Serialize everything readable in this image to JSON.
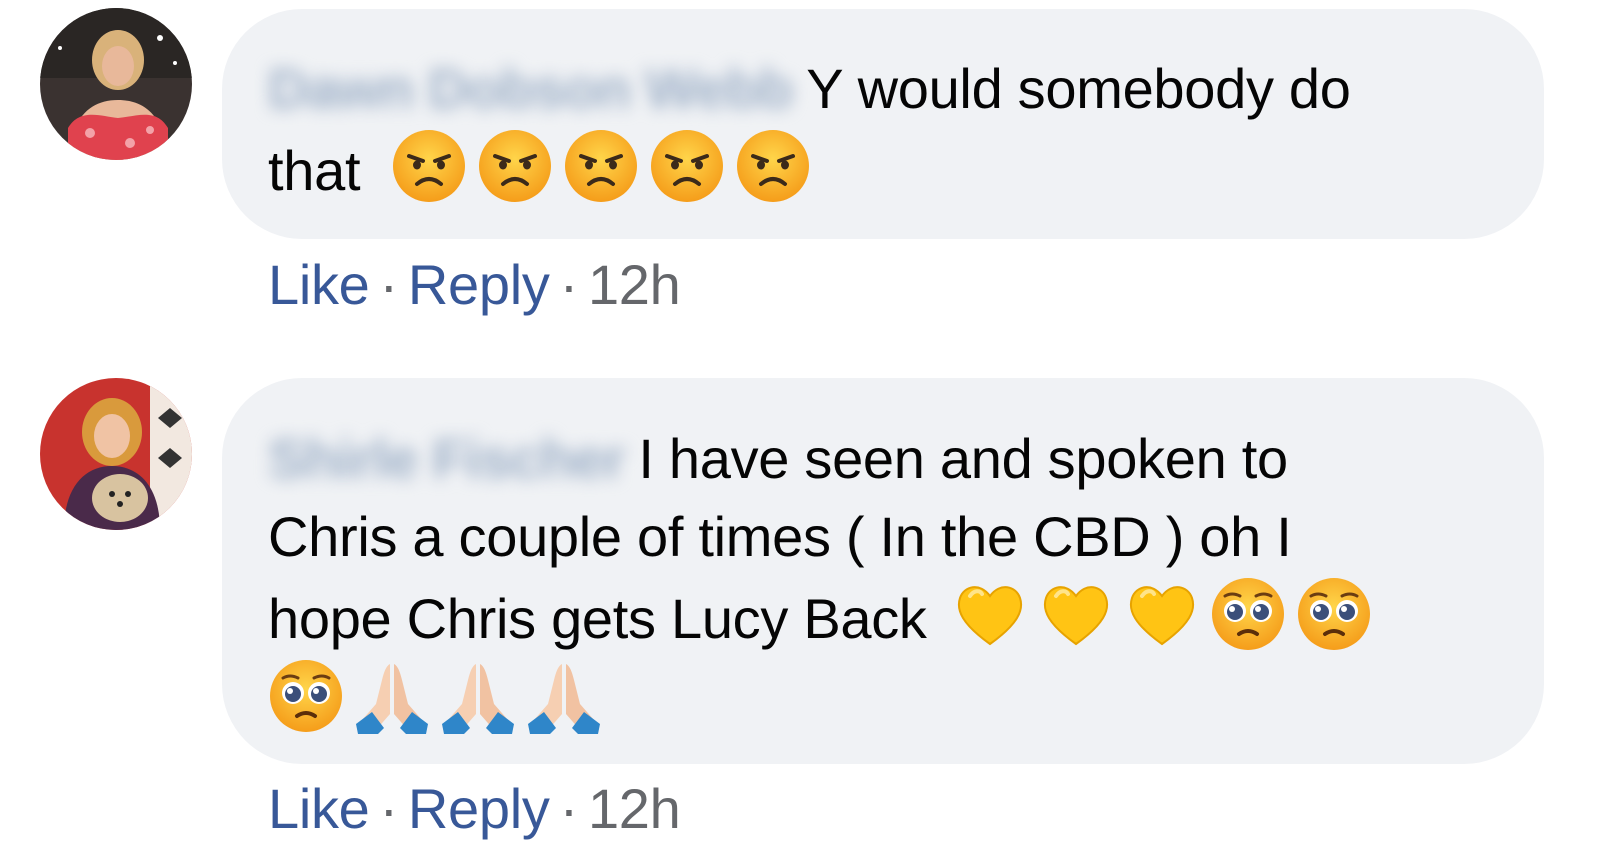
{
  "comments": [
    {
      "author": "Dawn Dobson Webb",
      "text_line1": "Y would somebody do",
      "text_line2": "that",
      "emojis": [
        "angry-face",
        "angry-face",
        "angry-face",
        "angry-face",
        "angry-face"
      ],
      "actions": {
        "like": "Like",
        "reply": "Reply",
        "separator": "·",
        "time": "12h"
      }
    },
    {
      "author": "Shirle Fischer",
      "text_line1": "I have seen and spoken to",
      "text_line2": "Chris a couple of times ( In the CBD ) oh I",
      "text_line3": "hope Chris gets Lucy Back",
      "emojis_line3": [
        "yellow-heart",
        "yellow-heart",
        "yellow-heart",
        "pleading-face",
        "pleading-face"
      ],
      "emojis_line4": [
        "pleading-face",
        "folded-hands",
        "folded-hands",
        "folded-hands"
      ],
      "actions": {
        "like": "Like",
        "reply": "Reply",
        "separator": "·",
        "time": "12h"
      }
    }
  ],
  "colors": {
    "bubble": "#f0f2f5",
    "link": "#385898",
    "meta": "#65676b",
    "text": "#050505"
  }
}
